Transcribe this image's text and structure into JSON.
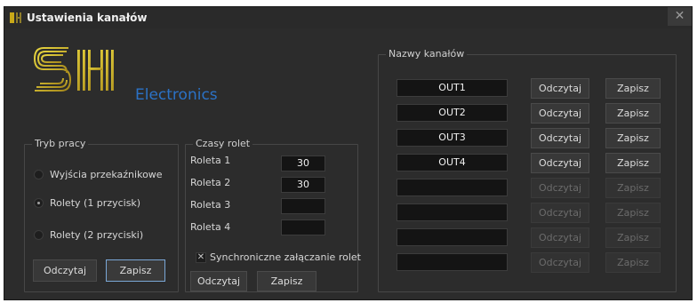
{
  "window": {
    "title": "Ustawienia kanałów",
    "close_label": "✕"
  },
  "logo": {
    "text": "Electronics"
  },
  "mode": {
    "title": "Tryb pracy",
    "options": [
      {
        "label": "Wyjścia przekaźnikowe",
        "checked": false
      },
      {
        "label": "Rolety (1 przycisk)",
        "checked": true
      },
      {
        "label": "Rolety (2 przyciski)",
        "checked": false
      }
    ],
    "read_label": "Odczytaj",
    "save_label": "Zapisz"
  },
  "blinds": {
    "title": "Czasy rolet",
    "rows": [
      {
        "label": "Roleta 1",
        "value": "30"
      },
      {
        "label": "Roleta 2",
        "value": "30"
      },
      {
        "label": "Roleta 3",
        "value": ""
      },
      {
        "label": "Roleta 4",
        "value": ""
      }
    ],
    "sync_label": "Synchroniczne załączanie rolet",
    "sync_checked": true,
    "read_label": "Odczytaj",
    "save_label": "Zapisz"
  },
  "names": {
    "title": "Nazwy kanałów",
    "channels": [
      {
        "value": "OUT1",
        "read": "Odczytaj",
        "save": "Zapisz",
        "enabled": true
      },
      {
        "value": "OUT2",
        "read": "Odczytaj",
        "save": "Zapisz",
        "enabled": true
      },
      {
        "value": "OUT3",
        "read": "Odczytaj",
        "save": "Zapisz",
        "enabled": true
      },
      {
        "value": "OUT4",
        "read": "Odczytaj",
        "save": "Zapisz",
        "enabled": true
      },
      {
        "value": "",
        "read": "Odczytaj",
        "save": "Zapisz",
        "enabled": false
      },
      {
        "value": "",
        "read": "Odczytaj",
        "save": "Zapisz",
        "enabled": false
      },
      {
        "value": "",
        "read": "Odczytaj",
        "save": "Zapisz",
        "enabled": false
      },
      {
        "value": "",
        "read": "Odczytaj",
        "save": "Zapisz",
        "enabled": false
      }
    ]
  },
  "colors": {
    "background": "#2c2c2c",
    "accent": "#7aa7d6",
    "logo_blue": "#2b72c6",
    "logo_gold": "#c9a818"
  }
}
